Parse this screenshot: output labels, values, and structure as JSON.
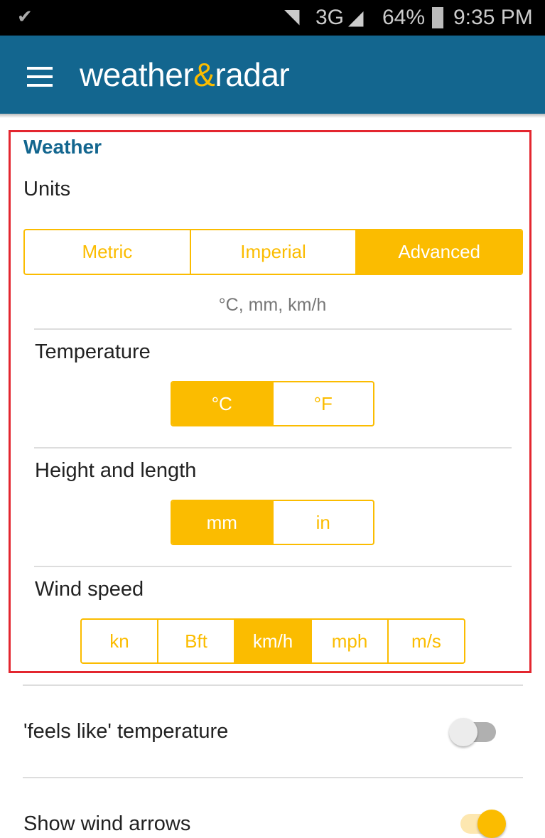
{
  "status_bar": {
    "network": "3G",
    "battery": "64%",
    "time": "9:35 PM"
  },
  "app_bar": {
    "logo_left": "weather",
    "logo_amp": "&",
    "logo_right": "radar"
  },
  "section": {
    "title": "Weather",
    "units_label": "Units",
    "units_options": [
      {
        "label": "Metric",
        "selected": false
      },
      {
        "label": "Imperial",
        "selected": false
      },
      {
        "label": "Advanced",
        "selected": true
      }
    ],
    "units_summary": "°C, mm, km/h",
    "temperature": {
      "label": "Temperature",
      "options": [
        {
          "label": "°C",
          "selected": true
        },
        {
          "label": "°F",
          "selected": false
        }
      ]
    },
    "height": {
      "label": "Height and length",
      "options": [
        {
          "label": "mm",
          "selected": true
        },
        {
          "label": "in",
          "selected": false
        }
      ]
    },
    "wind": {
      "label": "Wind speed",
      "options": [
        {
          "label": "kn",
          "selected": false
        },
        {
          "label": "Bft",
          "selected": false
        },
        {
          "label": "km/h",
          "selected": true
        },
        {
          "label": "mph",
          "selected": false
        },
        {
          "label": "m/s",
          "selected": false
        }
      ]
    }
  },
  "settings": [
    {
      "label": "'feels like' temperature",
      "on": false
    },
    {
      "label": "Show wind arrows",
      "on": true
    }
  ],
  "colors": {
    "accent": "#fbbc00",
    "brand": "#13668f",
    "highlight": "#e3262f"
  }
}
